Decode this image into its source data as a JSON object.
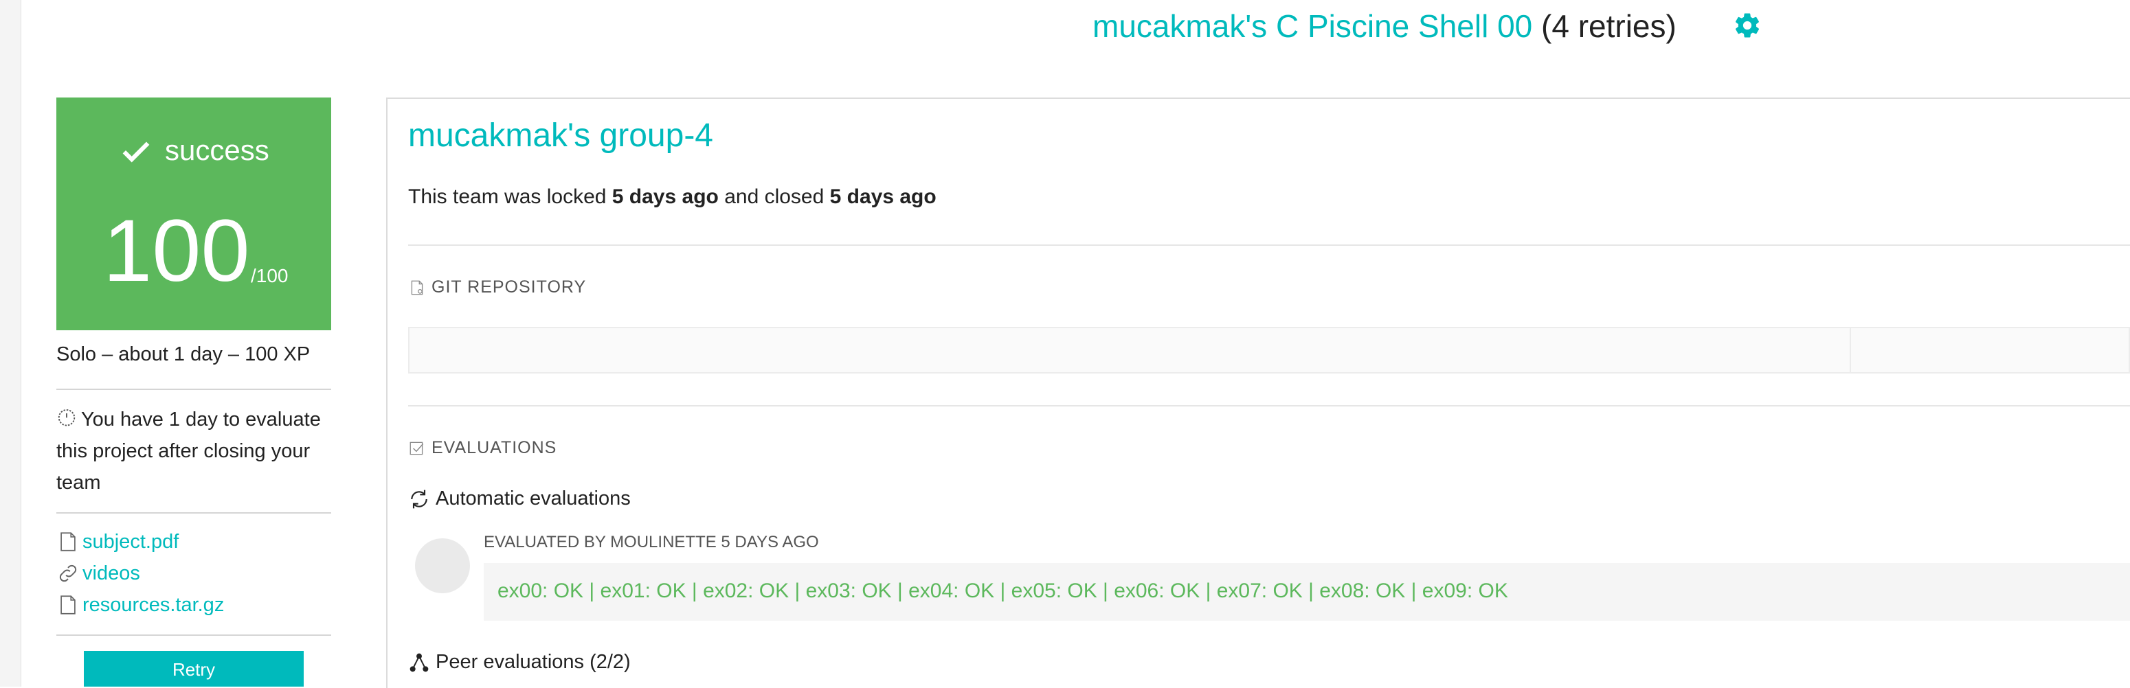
{
  "header": {
    "project_title": "mucakmak's C Piscine Shell 00",
    "retries": "(4 retries)",
    "settings_icon": "gear-icon"
  },
  "sidebar": {
    "status": "success",
    "score": "100",
    "score_max": "/100",
    "meta": "Solo – about 1 day – 100 XP",
    "evaluation_notice": "You have 1 day to evaluate this project after closing your team",
    "links": [
      {
        "label": "subject.pdf",
        "icon": "file-icon"
      },
      {
        "label": "videos",
        "icon": "link-icon"
      },
      {
        "label": "resources.tar.gz",
        "icon": "file-icon"
      }
    ],
    "retry_label": "Retry"
  },
  "main": {
    "group_title": "mucakmak's group-4",
    "team_status": {
      "prefix": "This team was locked ",
      "locked": "5 days ago",
      "middle": " and closed ",
      "closed": "5 days ago"
    },
    "git_repository_label": "GIT REPOSITORY",
    "evaluations_label": "EVALUATIONS",
    "automatic_evaluations_label": "Automatic evaluations",
    "evaluated_by": "EVALUATED BY MOULINETTE 5 DAYS AGO",
    "result": "ex00: OK | ex01: OK | ex02: OK | ex03: OK | ex04: OK | ex05: OK | ex06: OK | ex07: OK | ex08: OK | ex09: OK",
    "peer_evaluations_label": "Peer evaluations (2/2)"
  },
  "colors": {
    "accent": "#00babc",
    "success": "#5cb85c"
  }
}
